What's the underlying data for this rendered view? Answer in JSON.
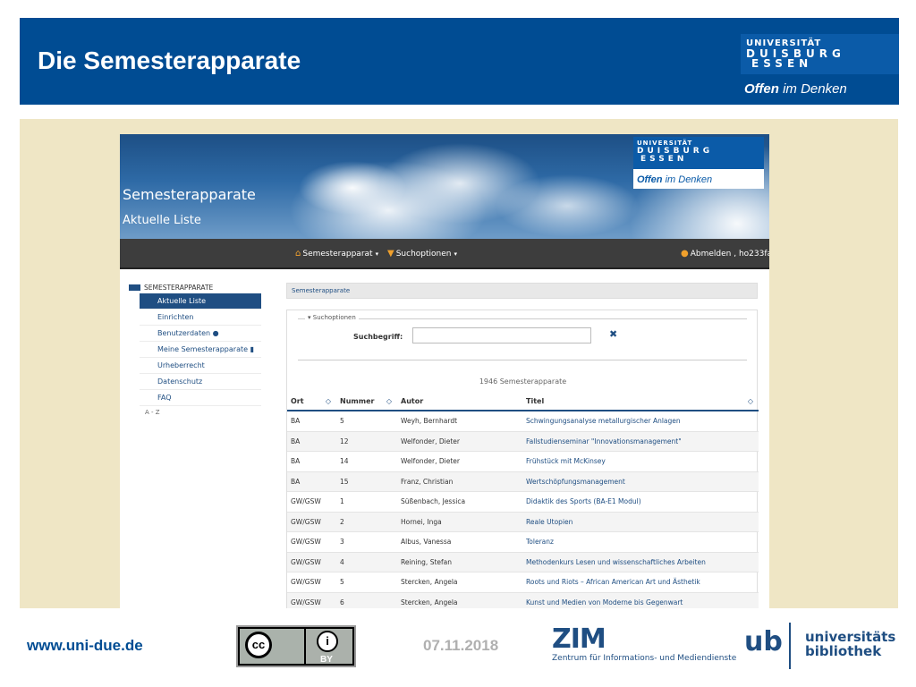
{
  "slide": {
    "title": "Die Semesterapparate",
    "logo_line1": "UNIVERSITÄT",
    "logo_line2": "DUISBURG",
    "logo_line3": "ESSEN",
    "slogan_bold": "Offen",
    "slogan_rest": " im Denken"
  },
  "app": {
    "title": "Semesterapparate",
    "subtitle": "Aktuelle Liste",
    "navbar": {
      "menu1": "Semesterapparat",
      "menu2": "Suchoptionen",
      "user": "Abmelden , ho233fa",
      "menu1_icon": "home-icon",
      "menu2_icon": "filter-icon",
      "user_icon": "user-icon"
    },
    "sidebar": {
      "heading": "SEMESTERAPPARATE",
      "items": [
        {
          "label": "Aktuelle Liste"
        },
        {
          "label": "Einrichten"
        },
        {
          "label": "Benutzerdaten"
        },
        {
          "label": "Meine Semesterapparate"
        },
        {
          "label": "Urheberrecht"
        },
        {
          "label": "Datenschutz"
        },
        {
          "label": "FAQ"
        }
      ],
      "az": "A - Z"
    },
    "breadcrumb": "Semesterapparate",
    "search": {
      "legend": "Suchoptionen",
      "label": "Suchbegriff:",
      "value": "",
      "placeholder": ""
    },
    "count_text": "1946 Semesterapparate",
    "table": {
      "headers": [
        "Ort",
        "Nummer",
        "Autor",
        "Titel"
      ],
      "rows": [
        {
          "ort": "BA",
          "nummer": "5",
          "autor": "Weyh, Bernhardt",
          "titel": "Schwingungsanalyse metallurgischer Anlagen"
        },
        {
          "ort": "BA",
          "nummer": "12",
          "autor": "Welfonder, Dieter",
          "titel": "Fallstudienseminar \"Innovationsmanagement\""
        },
        {
          "ort": "BA",
          "nummer": "14",
          "autor": "Welfonder, Dieter",
          "titel": "Frühstück mit McKinsey"
        },
        {
          "ort": "BA",
          "nummer": "15",
          "autor": "Franz, Christian",
          "titel": "Wertschöpfungsmanagement"
        },
        {
          "ort": "GW/GSW",
          "nummer": "1",
          "autor": "Süßenbach, Jessica",
          "titel": "Didaktik des Sports (BA-E1 Modul)"
        },
        {
          "ort": "GW/GSW",
          "nummer": "2",
          "autor": "Hornei, Inga",
          "titel": "Reale Utopien"
        },
        {
          "ort": "GW/GSW",
          "nummer": "3",
          "autor": "Albus, Vanessa",
          "titel": "Toleranz"
        },
        {
          "ort": "GW/GSW",
          "nummer": "4",
          "autor": "Reining, Stefan",
          "titel": "Methodenkurs Lesen und wissenschaftliches Arbeiten"
        },
        {
          "ort": "GW/GSW",
          "nummer": "5",
          "autor": "Stercken, Angela",
          "titel": "Roots und Riots – African American Art und Ästhetik"
        },
        {
          "ort": "GW/GSW",
          "nummer": "6",
          "autor": "Stercken, Angela",
          "titel": "Kunst und Medien von Moderne bis Gegenwart"
        }
      ]
    }
  },
  "footer": {
    "url": "www.uni-due.de",
    "date": "07.11.2018",
    "cc_label": "BY",
    "zim_logo": "ZIM",
    "zim_sub": "Zentrum für Informations- und Mediendienste",
    "ub_logo": "ub",
    "ub_line1": "universitäts",
    "ub_line2": "bibliothek"
  },
  "colors": {
    "header_blue": "#004c93",
    "content_beige": "#efe6c5",
    "link_blue": "#1f4e82",
    "nav_dark": "#3d3d3d"
  }
}
